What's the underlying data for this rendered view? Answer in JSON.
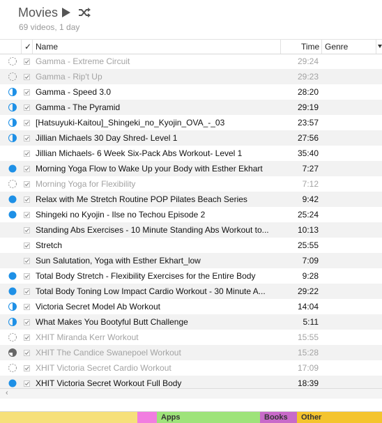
{
  "header": {
    "title": "Movies",
    "subtitle": "69 videos, 1 day"
  },
  "columns": {
    "check": "✓",
    "name": "Name",
    "time": "Time",
    "genre": "Genre"
  },
  "rows": [
    {
      "status": "none",
      "name": "Gamma - Extreme Circuit",
      "time": "29:24",
      "dimmed": true
    },
    {
      "status": "none",
      "name": "Gamma - Rip't Up",
      "time": "29:23",
      "dimmed": true
    },
    {
      "status": "half",
      "name": "Gamma - Speed 3.0",
      "time": "28:20",
      "dimmed": false
    },
    {
      "status": "half",
      "name": "Gamma - The Pyramid",
      "time": "29:19",
      "dimmed": false
    },
    {
      "status": "half",
      "name": "[Hatsuyuki-Kaitou]_Shingeki_no_Kyojin_OVA_-_03",
      "time": "23:57",
      "dimmed": false
    },
    {
      "status": "half",
      "name": "Jillian Michaels 30 Day Shred- Level 1",
      "time": "27:56",
      "dimmed": false
    },
    {
      "status": "empty",
      "name": "Jillian Michaels- 6 Week Six-Pack Abs Workout- Level 1",
      "time": "35:40",
      "dimmed": false
    },
    {
      "status": "full",
      "name": "Morning Yoga Flow to Wake Up your Body with Esther Ekhart",
      "time": "7:27",
      "dimmed": false
    },
    {
      "status": "none",
      "name": "Morning Yoga for Flexibility",
      "time": "7:12",
      "dimmed": true
    },
    {
      "status": "full",
      "name": "Relax with Me Stretch Routine POP Pilates Beach Series",
      "time": "9:42",
      "dimmed": false
    },
    {
      "status": "full",
      "name": "Shingeki no Kyojin - Ilse no Techou Episode 2",
      "time": "25:24",
      "dimmed": false
    },
    {
      "status": "empty",
      "name": "Standing Abs Exercises - 10 Minute Standing Abs Workout to...",
      "time": "10:13",
      "dimmed": false
    },
    {
      "status": "empty",
      "name": "Stretch",
      "time": "25:55",
      "dimmed": false
    },
    {
      "status": "empty",
      "name": "Sun Salutation, Yoga with Esther Ekhart_low",
      "time": "7:09",
      "dimmed": false
    },
    {
      "status": "full",
      "name": "Total Body Stretch - Flexibility Exercises for the Entire Body",
      "time": "9:28",
      "dimmed": false
    },
    {
      "status": "full",
      "name": "Total Body Toning Low Impact Cardio Workout - 30 Minute A...",
      "time": "29:22",
      "dimmed": false
    },
    {
      "status": "half",
      "name": "Victoria Secret Model Ab Workout",
      "time": "14:04",
      "dimmed": false
    },
    {
      "status": "half",
      "name": "What Makes You Bootyful Butt Challenge",
      "time": "5:11",
      "dimmed": false
    },
    {
      "status": "none",
      "name": "XHIT Miranda Kerr Workout",
      "time": "15:55",
      "dimmed": true
    },
    {
      "status": "half-gray",
      "name": "XHIT The Candice Swanepoel Workout",
      "time": "15:28",
      "dimmed": true
    },
    {
      "status": "none",
      "name": "XHIT Victoria Secret Cardio Workout",
      "time": "17:09",
      "dimmed": true
    },
    {
      "status": "full",
      "name": "XHIT Victoria Secret Workout Full Body",
      "time": "18:39",
      "dimmed": false
    }
  ],
  "capacity": {
    "segments": [
      {
        "label": "",
        "color": "#f6e07a"
      },
      {
        "label": "",
        "color": "#f17de0"
      },
      {
        "label": "Apps",
        "color": "#9ee37a"
      },
      {
        "label": "Books",
        "color": "#c86ac9"
      },
      {
        "label": "Other",
        "color": "#f4c42e"
      }
    ]
  },
  "colors": {
    "accent_blue": "#1e90e6"
  }
}
